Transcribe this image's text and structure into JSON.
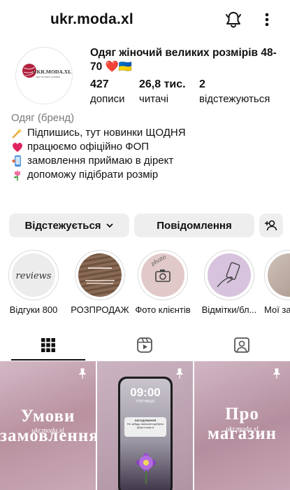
{
  "header": {
    "username": "ukr.moda.xl"
  },
  "profile": {
    "full_name": "Одяг жіночий великих розмірів 48-70 ❤️🇺🇦",
    "avatar_text": "UKR.MODA.XL",
    "avatar_subtext": "одяг великих розмірів",
    "stats": [
      {
        "value": "427",
        "label": "дописи"
      },
      {
        "value": "26,8 тис.",
        "label": "читачі"
      },
      {
        "value": "2",
        "label": "відстежуються"
      }
    ],
    "category": "Одяг (бренд)",
    "bio_lines": [
      {
        "icon": "sparkle-emoji",
        "text": "Підпишись, тут новинки ЩОДНЯ"
      },
      {
        "icon": "heart-emoji",
        "text": "працюємо офіційно ФОП"
      },
      {
        "icon": "phone-emoji",
        "text": "замовлення приймаю в дірект"
      },
      {
        "icon": "tulip-emoji",
        "text": "допоможу підібрати розмір"
      }
    ]
  },
  "actions": {
    "follow_label": "Відстежується",
    "message_label": "Повідомлення"
  },
  "highlights": [
    {
      "label": "Відгуки 800",
      "cover_text": "reviews"
    },
    {
      "label": "РОЗПРОДАЖ",
      "cover_text": ""
    },
    {
      "label": "Фото клієнтів",
      "cover_text": "photo"
    },
    {
      "label": "Відмітки/бл...",
      "cover_text": ""
    },
    {
      "label": "Мої за",
      "cover_text": ""
    }
  ],
  "tabs": [
    {
      "name": "grid-icon",
      "active": true
    },
    {
      "name": "reels-icon",
      "active": false
    },
    {
      "name": "tagged-icon",
      "active": false
    }
  ],
  "posts": [
    {
      "title": "Умови замовлення",
      "subtitle": "ukr.moda.xl"
    },
    {
      "phone_time": "09:00",
      "phone_date": "П'ЯТНИЦЯ",
      "notif_title": "НАГАДУВАННЯ",
      "notif_text": "Не забудь написати добірно @ukr.moda.xl"
    },
    {
      "title": "Про магазин",
      "subtitle": "ukr.moda.xl"
    }
  ],
  "colors": {
    "accent_bg": "#eeeeee",
    "post_bg": "#c6a8b6",
    "muted_text": "#7a7a7a"
  }
}
